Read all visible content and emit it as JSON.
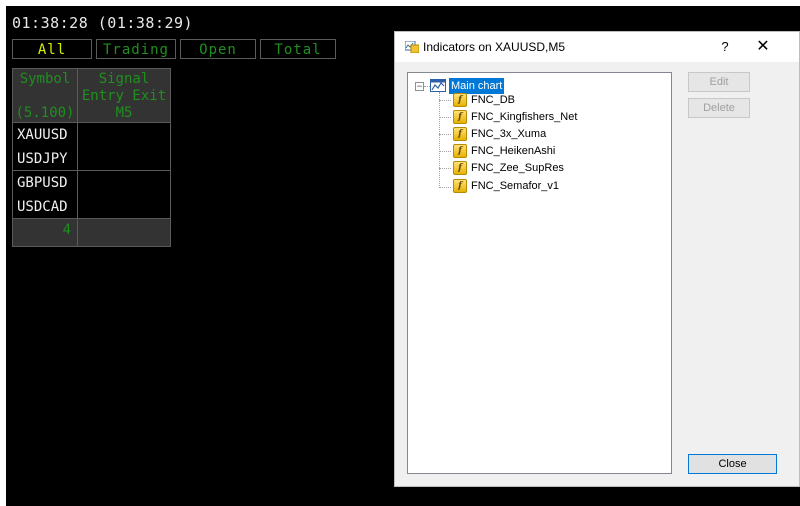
{
  "clock": "01:38:28 (01:38:29)",
  "tabs": [
    {
      "label": "All",
      "active": true
    },
    {
      "label": "Trading",
      "active": false
    },
    {
      "label": "Open",
      "active": false
    },
    {
      "label": "Total",
      "active": false
    }
  ],
  "table": {
    "symbol_header": "Symbol",
    "symbol_sub": "(5.100)",
    "signal_header": "Signal",
    "entry_exit": "Entry Exit",
    "timeframe": "M5",
    "groups": [
      [
        "XAUUSD",
        "USDJPY"
      ],
      [
        "GBPUSD",
        "USDCAD"
      ]
    ],
    "count": "4"
  },
  "dialog": {
    "title": "Indicators on XAUUSD,M5",
    "help": "?",
    "close_x": "✕",
    "root": "Main chart",
    "indicators": [
      "FNC_DB",
      "FNC_Kingfishers_Net",
      "FNC_3x_Xuma",
      "FNC_HeikenAshi",
      "FNC_Zee_SupRes",
      "FNC_Semafor_v1"
    ],
    "buttons": {
      "edit": "Edit",
      "delete": "Delete",
      "close": "Close"
    }
  },
  "colors": {
    "chart_bg": "#000000",
    "accent_green": "#1f8f1f",
    "active_tab_text": "#d8f000"
  }
}
